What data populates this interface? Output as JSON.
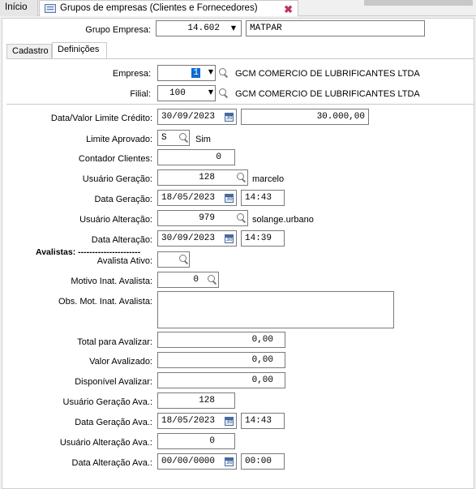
{
  "tabs": {
    "inicio": "Início",
    "grupos": "Grupos de empresas (Clientes e Fornecedores)"
  },
  "header": {
    "grupo_label": "Grupo Empresa:",
    "grupo_value": "14.602",
    "grupo_name": "MATPAR"
  },
  "subtabs": {
    "cadastro": "Cadastro",
    "definicoes": "Definições"
  },
  "empresa": {
    "label": "Empresa:",
    "value": "1",
    "name": "GCM COMERCIO DE LUBRIFICANTES LTDA"
  },
  "filial": {
    "label": "Filial:",
    "value": "100",
    "name": "GCM COMERCIO DE LUBRIFICANTES LTDA"
  },
  "form": {
    "limite_label": "Data/Valor Limite Crédito:",
    "limite_date": "30/09/2023",
    "limite_value": "30.000,00",
    "aprovado_label": "Limite Aprovado:",
    "aprovado_value": "S",
    "aprovado_desc": "Sim",
    "contador_label": "Contador Clientes:",
    "contador_value": "0",
    "usuario_geracao_label": "Usuário Geração:",
    "usuario_geracao_value": "128",
    "usuario_geracao_desc": "marcelo",
    "data_geracao_label": "Data Geração:",
    "data_geracao_date": "18/05/2023",
    "data_geracao_time": "14:43",
    "usuario_alteracao_label": "Usuário Alteração:",
    "usuario_alteracao_value": "979",
    "usuario_alteracao_desc": "solange.urbano",
    "data_alteracao_label": "Data Alteração:",
    "data_alteracao_date": "30/09/2023",
    "data_alteracao_time": "14:39",
    "avalistas_title": "Avalistas: ----------------------",
    "avalista_ativo_label": "Avalista Ativo:",
    "avalista_ativo_value": "",
    "motivo_label": "Motivo Inat. Avalista:",
    "motivo_value": "0",
    "obs_label": "Obs. Mot. Inat. Avalista:",
    "obs_value": "",
    "total_label": "Total para Avalizar:",
    "total_value": "0,00",
    "valor_label": "Valor Avalizado:",
    "valor_value": "0,00",
    "disponivel_label": "Disponível Avalizar:",
    "disponivel_value": "0,00",
    "usr_ger_ava_label": "Usuário Geração Ava.:",
    "usr_ger_ava_value": "128",
    "data_ger_ava_label": "Data Geração Ava.:",
    "data_ger_ava_date": "18/05/2023",
    "data_ger_ava_time": "14:43",
    "usr_alt_ava_label": "Usuário Alteração Ava.:",
    "usr_alt_ava_value": "0",
    "data_alt_ava_label": "Data Alteração Ava.:",
    "data_alt_ava_date": "00/00/0000",
    "data_alt_ava_time": "00:00"
  },
  "icons": {
    "dropdown": "chevron-down-icon",
    "search": "search-icon",
    "calendar": "calendar-icon",
    "close": "close-icon",
    "window": "window-icon"
  },
  "colors": {
    "selection": "#0b6bd0",
    "close": "#c0306a"
  }
}
